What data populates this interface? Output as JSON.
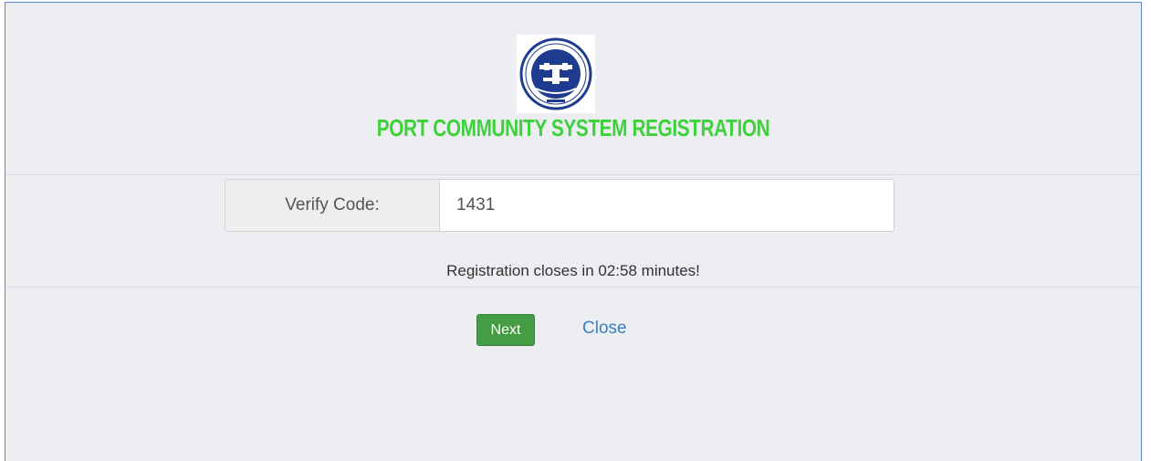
{
  "header": {
    "logo_icon": "port-authority-emblem-icon",
    "title": "PORT COMMUNITY SYSTEM REGISTRATION",
    "title_color": "#3dd23b"
  },
  "verify": {
    "label": "Verify Code:",
    "value": "1431"
  },
  "countdown_text": "Registration closes in 02:58 minutes!",
  "actions": {
    "next_label": "Next",
    "close_label": "Close",
    "next_color": "#449d44",
    "link_color": "#3a7fc4"
  }
}
